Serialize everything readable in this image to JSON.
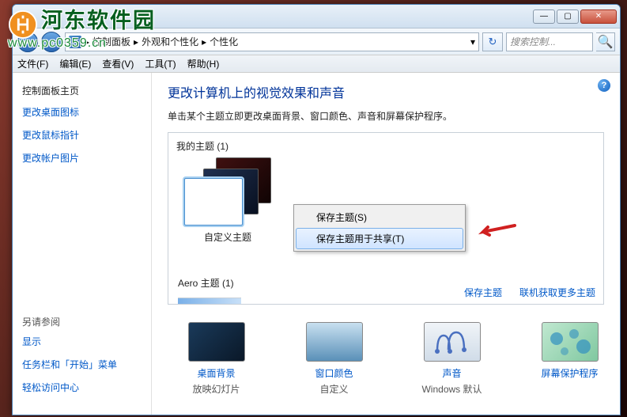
{
  "watermark": {
    "name": "河东软件园",
    "url": "www.pc0359.cn"
  },
  "titlebar": {
    "min": "—",
    "max": "▢",
    "close": "✕"
  },
  "address": {
    "back": "←",
    "fwd": "→",
    "crumbs": [
      "控制面板",
      "外观和个性化",
      "个性化"
    ],
    "sep": "▸",
    "dd": "▾",
    "refresh": "↻",
    "search_placeholder": "搜索控制...",
    "search_icon": "🔍"
  },
  "menubar": [
    "文件(F)",
    "编辑(E)",
    "查看(V)",
    "工具(T)",
    "帮助(H)"
  ],
  "leftnav": {
    "heading": "控制面板主页",
    "links": [
      "更改桌面图标",
      "更改鼠标指针",
      "更改帐户图片"
    ],
    "see_also_heading": "另请参阅",
    "see_also": [
      "显示",
      "任务栏和「开始」菜单",
      "轻松访问中心"
    ]
  },
  "content": {
    "title": "更改计算机上的视觉效果和声音",
    "desc": "单击某个主题立即更改桌面背景、窗口颜色、声音和屏幕保护程序。",
    "my_themes_heading": "我的主题 (1)",
    "theme_name": "自定义主题",
    "aero_heading": "Aero 主题 (1)",
    "save_theme_link": "保存主题",
    "more_themes_link": "联机获取更多主题"
  },
  "context_menu": {
    "items": [
      "保存主题(S)",
      "保存主题用于共享(T)"
    ]
  },
  "bottom": {
    "items": [
      {
        "title": "桌面背景",
        "sub": "放映幻灯片"
      },
      {
        "title": "窗口颜色",
        "sub": "自定义"
      },
      {
        "title": "声音",
        "sub": "Windows 默认"
      },
      {
        "title": "屏幕保护程序",
        "sub": ""
      }
    ]
  },
  "help": "?"
}
